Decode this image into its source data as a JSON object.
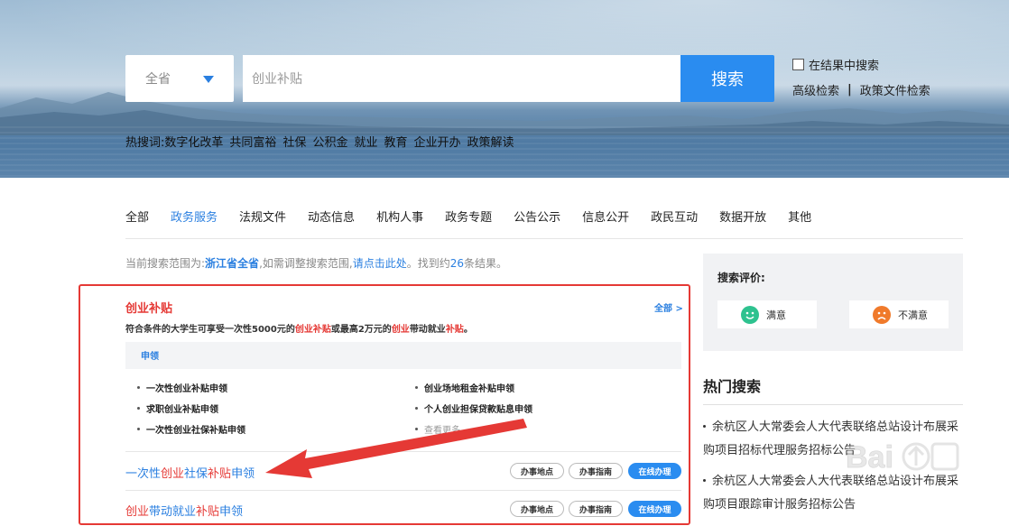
{
  "search": {
    "province": "全省",
    "placeholder": "创业补贴",
    "button": "搜索",
    "in_result": "在结果中搜索",
    "advanced": "高级检索",
    "separator": "|",
    "policy_search": "政策文件检索"
  },
  "hot": {
    "label": "热搜词:",
    "words": [
      "数字化改革",
      "共同富裕",
      "社保",
      "公积金",
      "就业",
      "教育",
      "企业开办",
      "政策解读"
    ]
  },
  "tabs": [
    "全部",
    "政务服务",
    "法规文件",
    "动态信息",
    "机构人事",
    "政务专题",
    "公告公示",
    "信息公开",
    "政民互动",
    "数据开放",
    "其他"
  ],
  "active_tab": 1,
  "scope": {
    "prefix": "当前搜索范围为:",
    "region": "浙江省全省",
    "middle": ",如需调整搜索范围,",
    "link": "请点击此处",
    "suffix_a": "。找到约",
    "count": "26",
    "suffix_b": "条结果。"
  },
  "card": {
    "title": "创业补贴",
    "all": "全部 >",
    "desc": {
      "p1": "符合条件的大学生可享受一次性5000元的",
      "r1": "创业补贴",
      "p2": "或最高2万元的",
      "r2": "创业",
      "p3": "带动就业",
      "r3": "补贴",
      "p4": "。"
    },
    "section": "申领",
    "items_left": [
      "一次性创业补贴申领",
      "求职创业补贴申领",
      "一次性创业社保补贴申领"
    ],
    "items_right": [
      "创业场地租金补贴申领",
      "个人创业担保贷款贴息申领"
    ],
    "more": "查看更多"
  },
  "services": [
    {
      "parts": [
        {
          "t": "一次性",
          "red": false
        },
        {
          "t": "创业",
          "red": true
        },
        {
          "t": "社保",
          "red": false
        },
        {
          "t": "补贴",
          "red": true
        },
        {
          "t": "申领",
          "red": false
        }
      ],
      "buttons": [
        "办事地点",
        "办事指南",
        "在线办理"
      ]
    },
    {
      "parts": [
        {
          "t": "创业",
          "red": true
        },
        {
          "t": "带动就业",
          "red": false
        },
        {
          "t": "补贴",
          "red": true
        },
        {
          "t": "申领",
          "red": false
        }
      ],
      "buttons": [
        "办事地点",
        "办事指南",
        "在线办理"
      ]
    }
  ],
  "evaluation": {
    "title": "搜索评价:",
    "good": "满意",
    "bad": "不满意"
  },
  "hot_search": {
    "title": "热门搜索",
    "items": [
      [
        "余杭区人大常委会人大代表联络总站设计布展采",
        "购项目招标代理服务招标公告"
      ],
      [
        "余杭区人大常委会人大代表联络总站设计布展采",
        "购项目跟踪审计服务招标公告"
      ]
    ]
  },
  "colors": {
    "accent": "#2a8cf0",
    "highlight": "#e53935"
  }
}
